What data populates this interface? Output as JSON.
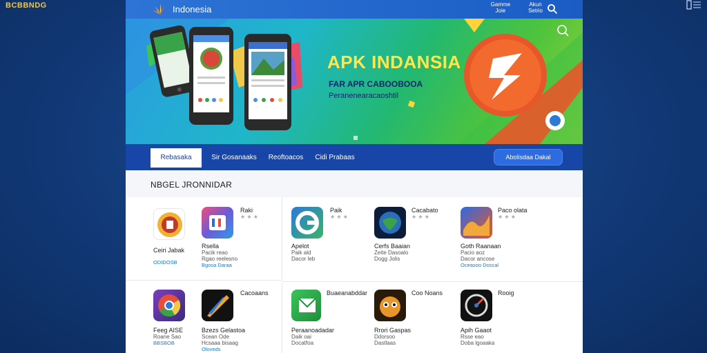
{
  "corner": {
    "left_text": "BCBBNDG",
    "right_icon": "reader-icon"
  },
  "header": {
    "brand": "Indonesia",
    "nav": [
      [
        "Gamme",
        "Joie"
      ],
      [
        "Akun",
        "Setrio"
      ]
    ]
  },
  "banner": {
    "title": "APK INDANSIA",
    "subtitle": "FAR APR CABOOBOOA",
    "tagline": "Peranenearacaoshtil"
  },
  "tabs": [
    {
      "label": "Rebasaka",
      "active": true
    },
    {
      "label": "Sir Gosanaaks",
      "active": false
    },
    {
      "label": "Reoftoacos",
      "active": false
    },
    {
      "label": "Cidi Prabaas",
      "active": false
    }
  ],
  "cta": "Abolisdaa Dakal",
  "section_title": "NBGEL JRONNIDAR",
  "apps_row1": [
    {
      "name": "Ceiri Jabak",
      "meta": "",
      "link": "ODIDOSB",
      "icon": "app-icon-bag"
    },
    {
      "name": "Rsella",
      "meta": "Pacik reao",
      "meta2": "Rgao reelesno",
      "link": "Bgosa Daraa",
      "extra": "Raki",
      "icon": "app-icon-calendar"
    },
    {
      "name": "Apelot",
      "meta": "Paik ald",
      "meta2": "Dacor leb",
      "link": "",
      "extra": "Paik",
      "icon": "app-icon-g"
    },
    {
      "name": "Cerfs Baaian",
      "meta": "Zeite Dasoalo",
      "meta2": "Dogg Jolis",
      "link": "",
      "extra": "Cacabato",
      "icon": "app-icon-globe"
    },
    {
      "name": "Goth Raanaan",
      "meta": "Pacio aoz",
      "meta2": "Dacor ancose",
      "link": "Oceasoo Doscal",
      "extra": "Paco olata",
      "icon": "app-icon-wave"
    }
  ],
  "apps_row2": [
    {
      "name": "Feeg AISE",
      "meta": "Roane Sao",
      "link": "BBSBOB",
      "icon": "app-icon-chrome"
    },
    {
      "name": "Bzezs Gelastoa",
      "meta": "Scean Ode",
      "meta2": "Hcsaaa bisaag",
      "link": "Oloveds",
      "extra": "Cacoaans",
      "icon": "app-icon-feather"
    },
    {
      "name": "Peraanoadadar",
      "meta": "Daik oai",
      "meta2": "Docatfoa",
      "link": "",
      "extra": "Buaeanabddar",
      "icon": "app-icon-mail"
    },
    {
      "name": "Rrori Gaspas",
      "meta": "Ddorsoo",
      "meta2": "Dastlaas",
      "link": "",
      "extra": "Coo Noans",
      "icon": "app-icon-robot"
    },
    {
      "name": "Apih Gaaot",
      "meta": "Rsse eao",
      "meta2": "Doba lgoaaka",
      "link": "",
      "extra": "Rooig",
      "icon": "app-icon-dial"
    }
  ],
  "colors": {
    "accent": "#1746a8",
    "banner_title": "#ffe64d",
    "link": "#1a78c2"
  }
}
